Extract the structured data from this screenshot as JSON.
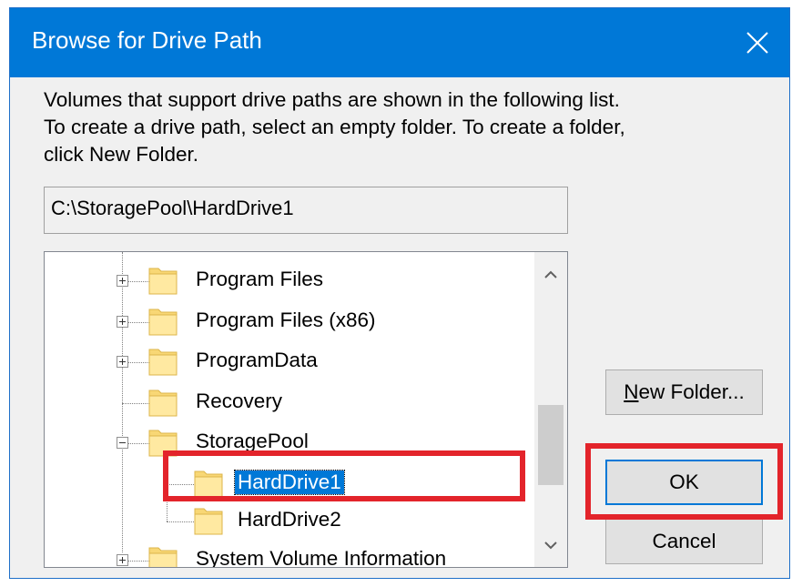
{
  "dialog": {
    "title": "Browse for Drive Path",
    "close_glyph": "×"
  },
  "description": {
    "line1": "Volumes that support drive paths are shown in the following list.",
    "line2": "To create a drive path, select an empty folder. To create a folder,",
    "line3": "click New Folder."
  },
  "path_field": {
    "value": "C:\\StoragePool\\HardDrive1"
  },
  "tree": {
    "items": [
      {
        "label": "Program Files",
        "icon": "folder-icon",
        "expander": "plus"
      },
      {
        "label": "Program Files (x86)",
        "icon": "folder-icon",
        "expander": "plus"
      },
      {
        "label": "ProgramData",
        "icon": "folder-icon",
        "expander": "plus"
      },
      {
        "label": "Recovery",
        "icon": "folder-icon",
        "expander": "none"
      },
      {
        "label": "StoragePool",
        "icon": "folder-icon",
        "expander": "minus"
      },
      {
        "label": "HardDrive1",
        "icon": "folder-icon",
        "expander": "none",
        "selected": true
      },
      {
        "label": "HardDrive2",
        "icon": "folder-icon",
        "expander": "none"
      },
      {
        "label": "System Volume Information",
        "icon": "folder-icon",
        "expander": "plus"
      }
    ]
  },
  "buttons": {
    "new_folder_prefix": "N",
    "new_folder_rest": "ew Folder...",
    "ok": "OK",
    "cancel": "Cancel"
  },
  "colors": {
    "titlebar": "#0078d7",
    "highlight": "#e3242b",
    "selection": "#0078d7"
  }
}
